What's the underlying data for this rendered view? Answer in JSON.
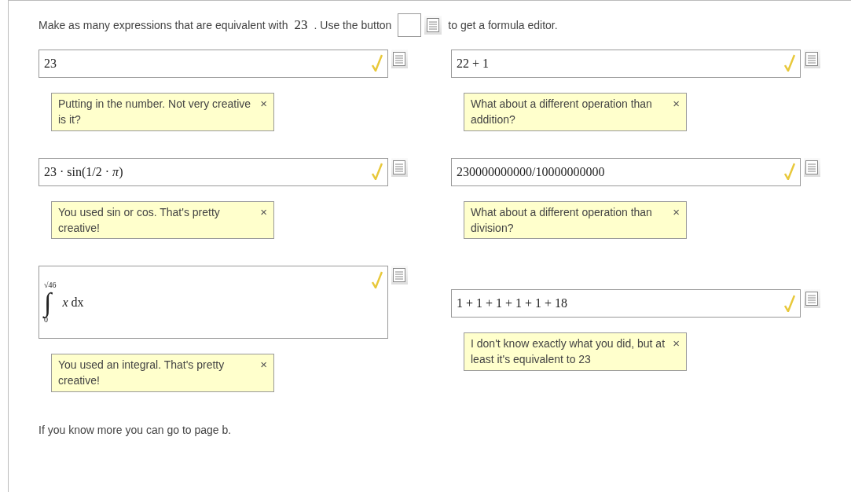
{
  "intro": {
    "before": "Make as many expressions that are equivalent with",
    "number": "23",
    "middle": ". Use the button",
    "after": "to get a formula editor."
  },
  "rows": [
    {
      "answers": [
        {
          "kind": "text",
          "expression": "23",
          "correct": true,
          "feedback": "Putting in the number. Not very creative is it?",
          "close": "×"
        },
        {
          "kind": "text",
          "expression": "22 + 1",
          "correct": true,
          "feedback": "What about a different operation than addition?",
          "close": "×"
        }
      ]
    },
    {
      "answers": [
        {
          "kind": "text",
          "expression": "23 · sin(1/2 · *π*)",
          "correct": true,
          "feedback": "You used sin or cos. That's pretty creative!",
          "close": "×"
        },
        {
          "kind": "text",
          "expression": "230000000000/10000000000",
          "correct": true,
          "feedback": "What about a different operation than division?",
          "close": "×"
        }
      ]
    },
    {
      "answers": [
        {
          "kind": "integral",
          "upper": "√46",
          "lower": "0",
          "sign": "∫",
          "expression": "*x* dx",
          "correct": true,
          "feedback": "You used an integral. That's pretty creative!",
          "close": "×"
        },
        {
          "kind": "text",
          "expression": "1 + 1 + 1 + 1 + 1 + 18",
          "correct": true,
          "feedback": "I don't know exactly what you did, but at least it's equivalent to 23",
          "close": "×"
        }
      ]
    }
  ],
  "footer": "If you know more you can go to page b."
}
